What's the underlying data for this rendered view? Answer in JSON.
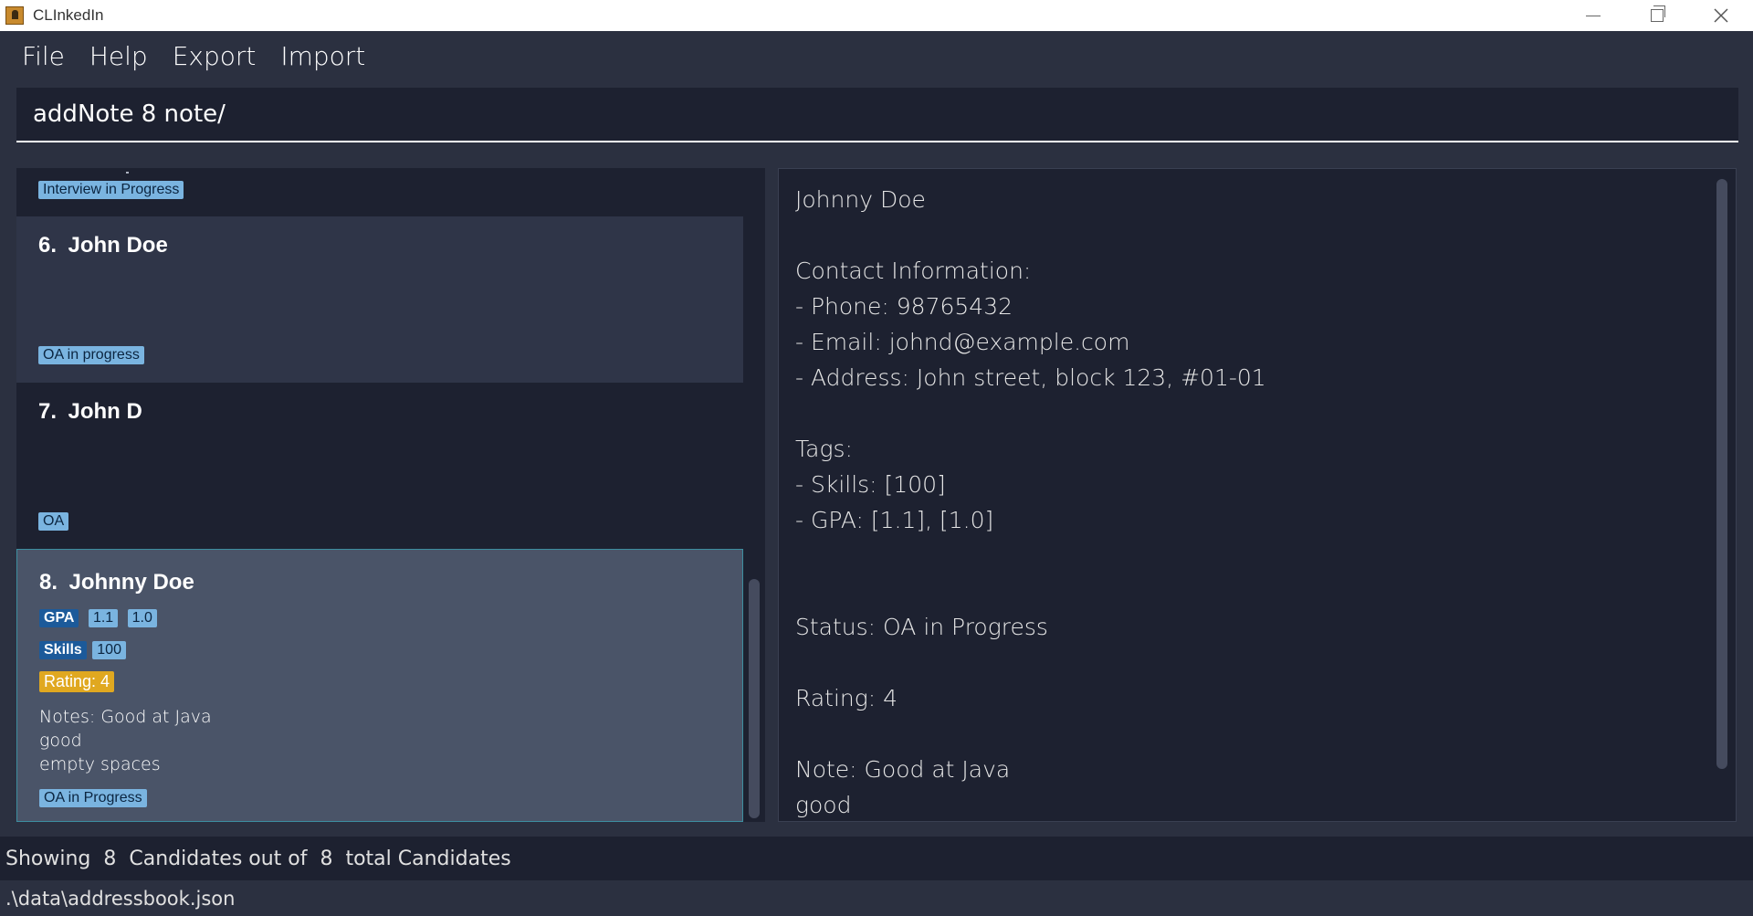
{
  "window": {
    "title": "CLInkedIn",
    "app_icon": "app-icon",
    "controls": [
      "minimize-icon",
      "restore-icon",
      "close-icon"
    ]
  },
  "menu": {
    "items": [
      "File",
      "Help",
      "Export",
      "Import"
    ]
  },
  "command": {
    "value": "addNote 8 note/"
  },
  "candidates": {
    "partial_top": {
      "status": "Interview in Progress"
    },
    "items": [
      {
        "index": "6.",
        "name": "John Doe",
        "status": "OA in progress"
      },
      {
        "index": "7.",
        "name": "John D",
        "status": "OA"
      },
      {
        "index": "8.",
        "name": "Johnny Doe",
        "gpa_label": "GPA",
        "gpa_values": [
          "1.1",
          "1.0"
        ],
        "skills_label": "Skills",
        "skills_values": [
          "100"
        ],
        "rating": "Rating: 4",
        "notes": [
          "Notes: Good at Java",
          "good",
          "empty spaces"
        ],
        "status": "OA in Progress"
      }
    ]
  },
  "detail": {
    "lines": [
      "Johnny Doe",
      "",
      "Contact Information:",
      "- Phone: 98765432",
      "- Email: johnd@example.com",
      "- Address: John street, block 123, #01-01",
      "",
      "Tags:",
      "- Skills: [100]",
      "- GPA: [1.1], [1.0]",
      "",
      "",
      "Status: OA in Progress",
      "",
      "Rating: 4",
      "",
      "Note: Good at Java",
      "good"
    ]
  },
  "status_bar": {
    "summary": "Showing  8  Candidates out of  8  total Candidates",
    "path": ".\\data\\addressbook.json"
  },
  "colors": {
    "background": "#1d2130",
    "panel": "#2b3040",
    "selected_card": "#4a5468",
    "card_alt": "#2f3548",
    "tag_blue_light": "#7ab4e0",
    "tag_blue_dark": "#1c5a9a",
    "rating": "#e0a820"
  }
}
